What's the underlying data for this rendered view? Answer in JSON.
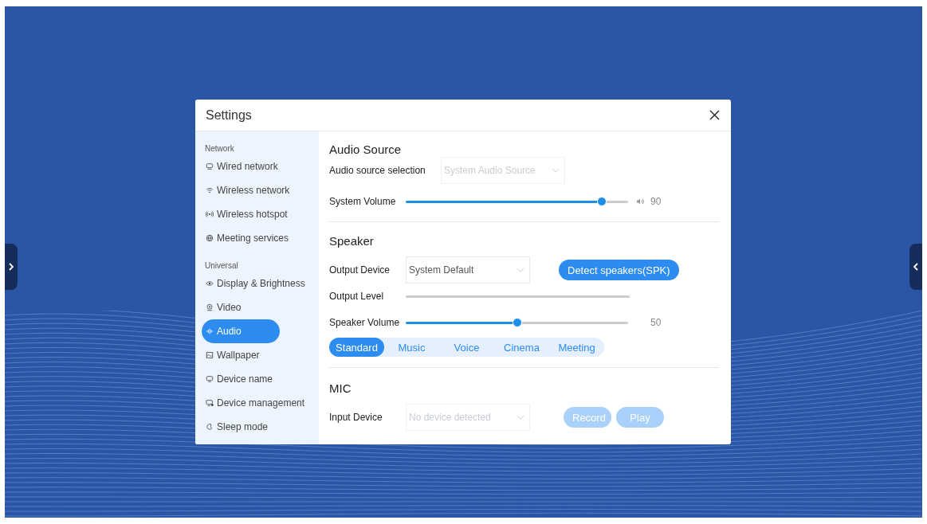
{
  "window": {
    "title": "Settings"
  },
  "sidebar": {
    "groups": [
      {
        "label": "Network",
        "items": [
          {
            "label": "Wired network",
            "selected": false
          },
          {
            "label": "Wireless network",
            "selected": false
          },
          {
            "label": "Wireless hotspot",
            "selected": false
          },
          {
            "label": "Meeting services",
            "selected": false
          }
        ]
      },
      {
        "label": "Universal",
        "items": [
          {
            "label": "Display & Brightness",
            "selected": false
          },
          {
            "label": "Video",
            "selected": false
          },
          {
            "label": "Audio",
            "selected": true
          },
          {
            "label": "Wallpaper",
            "selected": false
          },
          {
            "label": "Device name",
            "selected": false
          },
          {
            "label": "Device management",
            "selected": false
          },
          {
            "label": "Sleep mode",
            "selected": false
          }
        ]
      }
    ]
  },
  "audio_source": {
    "title": "Audio Source",
    "selection": {
      "label": "Audio source selection",
      "value": "System Audio Source",
      "disabled": true
    },
    "system_volume": {
      "label": "System Volume",
      "level": 0.88,
      "reading": "90"
    }
  },
  "speaker": {
    "title": "Speaker",
    "output_device": {
      "label": "Output Device",
      "value": "System Default",
      "disabled": false
    },
    "detect_button": {
      "label": "Detect speakers(SPK)",
      "disabled": false
    },
    "output_level": {
      "label": "Output Level",
      "level": 0
    },
    "speaker_volume": {
      "label": "Speaker Volume",
      "level": 0.5,
      "reading": "50"
    },
    "modes": [
      {
        "label": "Standard",
        "selected": true
      },
      {
        "label": "Music",
        "selected": false
      },
      {
        "label": "Voice",
        "selected": false
      },
      {
        "label": "Cinema",
        "selected": false
      },
      {
        "label": "Meeting",
        "selected": false
      }
    ]
  },
  "mic": {
    "title": "MIC",
    "input_device": {
      "label": "Input Device",
      "value": "No device detected",
      "disabled": true
    },
    "buttons": [
      {
        "label": "Record",
        "disabled": true
      },
      {
        "label": "Play",
        "disabled": true
      }
    ]
  }
}
